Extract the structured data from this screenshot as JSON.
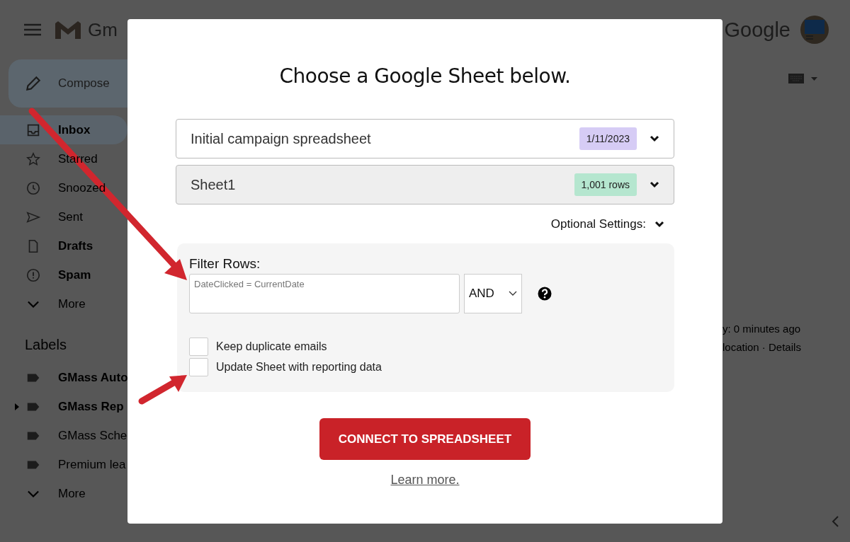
{
  "gmail": {
    "logo_text": "Gm",
    "compose": "Compose",
    "nav": [
      {
        "label": "Inbox",
        "bold": true,
        "selected": true,
        "kind": "inbox"
      },
      {
        "label": "Starred",
        "bold": false,
        "selected": false,
        "kind": "star"
      },
      {
        "label": "Snoozed",
        "bold": false,
        "selected": false,
        "kind": "clock"
      },
      {
        "label": "Sent",
        "bold": false,
        "selected": false,
        "kind": "send"
      },
      {
        "label": "Drafts",
        "bold": true,
        "selected": false,
        "kind": "file"
      },
      {
        "label": "Spam",
        "bold": true,
        "selected": false,
        "kind": "alert"
      },
      {
        "label": "More",
        "bold": false,
        "selected": false,
        "kind": "chevron"
      }
    ],
    "labels_heading": "Labels",
    "labels": [
      {
        "label": "GMass Auto",
        "bold": true,
        "expandable": false,
        "kind": "label"
      },
      {
        "label": "GMass Rep",
        "bold": true,
        "expandable": true,
        "kind": "label"
      },
      {
        "label": "GMass Sche",
        "bold": false,
        "expandable": false,
        "kind": "label"
      },
      {
        "label": "Premium lea",
        "bold": false,
        "expandable": false,
        "kind": "label"
      },
      {
        "label": "More",
        "bold": false,
        "expandable": false,
        "kind": "chevron"
      }
    ],
    "brand": "Google",
    "activity": [
      "y: 0 minutes ago",
      "location · Details"
    ]
  },
  "dialog": {
    "title": "Choose a Google Sheet below.",
    "selects": [
      {
        "value": "Initial campaign spreadsheet",
        "badge": "1/11/2023",
        "color": "#d6ccf5",
        "shaded": false
      },
      {
        "value": "Sheet1",
        "badge": "1,001 rows",
        "color": "#b5e6cf",
        "shaded": true
      }
    ],
    "optional_settings": "Optional Settings:",
    "filter_label": "Filter Rows:",
    "filter": {
      "placeholder": "DateClicked = CurrentDate"
    },
    "operator": "AND",
    "options": [
      {
        "label": "Keep duplicate emails",
        "checked": false
      },
      {
        "label": "Update Sheet with reporting data",
        "checked": false
      }
    ],
    "connect_button": "CONNECT TO SPREADSHEET",
    "learn_more": "Learn more."
  }
}
